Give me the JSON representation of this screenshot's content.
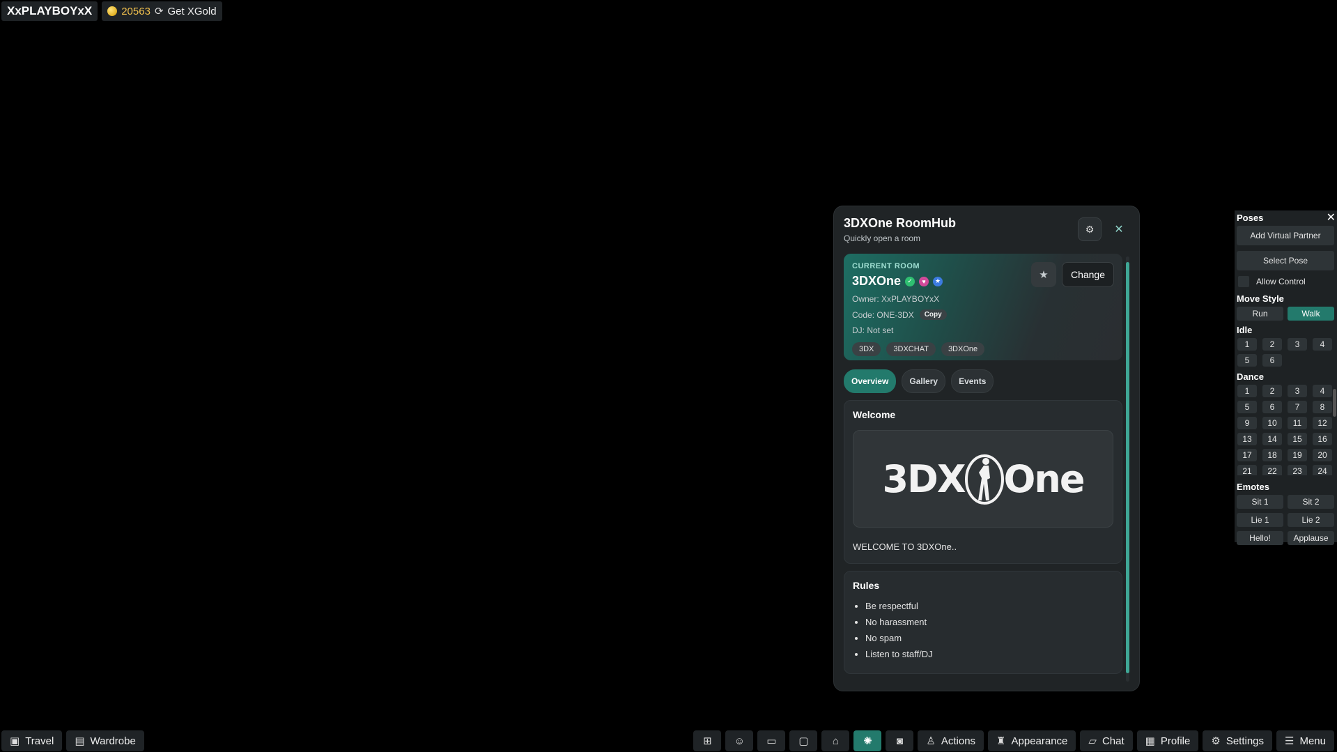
{
  "topbar": {
    "username": "XxPLAYBOYxX",
    "gold_amount": "20563",
    "get_gold_label": "Get XGold"
  },
  "hub": {
    "title": "3DXOne RoomHub",
    "subtitle": "Quickly open a room",
    "current_room": {
      "label": "CURRENT ROOM",
      "name": "3DXOne",
      "owner": "Owner: XxPLAYBOYxX",
      "code": "Code: ONE-3DX",
      "copy_label": "Copy",
      "dj": "DJ: Not set",
      "tags": [
        "3DX",
        "3DXCHAT",
        "3DXOne"
      ],
      "change_label": "Change"
    },
    "tabs": [
      "Overview",
      "Gallery",
      "Events"
    ],
    "welcome": {
      "title": "Welcome",
      "logo_left": "3DX",
      "logo_right": "One",
      "text": "WELCOME TO 3DXOne.."
    },
    "rules": {
      "title": "Rules",
      "items": [
        "Be respectful",
        "No harassment",
        "No spam",
        "Listen to staff/DJ"
      ]
    }
  },
  "poses": {
    "title": "Poses",
    "add_partner": "Add Virtual Partner",
    "select_pose": "Select Pose",
    "allow_control": "Allow Control",
    "move_style": {
      "title": "Move Style",
      "run": "Run",
      "walk": "Walk",
      "selected": "Walk"
    },
    "idle": {
      "title": "Idle",
      "items": [
        "1",
        "2",
        "3",
        "4",
        "5",
        "6"
      ]
    },
    "dance": {
      "title": "Dance",
      "items": [
        "1",
        "2",
        "3",
        "4",
        "5",
        "6",
        "7",
        "8",
        "9",
        "10",
        "11",
        "12",
        "13",
        "14",
        "15",
        "16",
        "17",
        "18",
        "19",
        "20",
        "21",
        "22",
        "23",
        "24"
      ]
    },
    "emotes": {
      "title": "Emotes",
      "items": [
        "Sit 1",
        "Sit 2",
        "Lie 1",
        "Lie 2",
        "Hello!",
        "Applause"
      ]
    }
  },
  "bottombar": {
    "travel": "Travel",
    "wardrobe": "Wardrobe",
    "actions": "Actions",
    "appearance": "Appearance",
    "chat": "Chat",
    "profile": "Profile",
    "settings": "Settings",
    "menu": "Menu"
  }
}
